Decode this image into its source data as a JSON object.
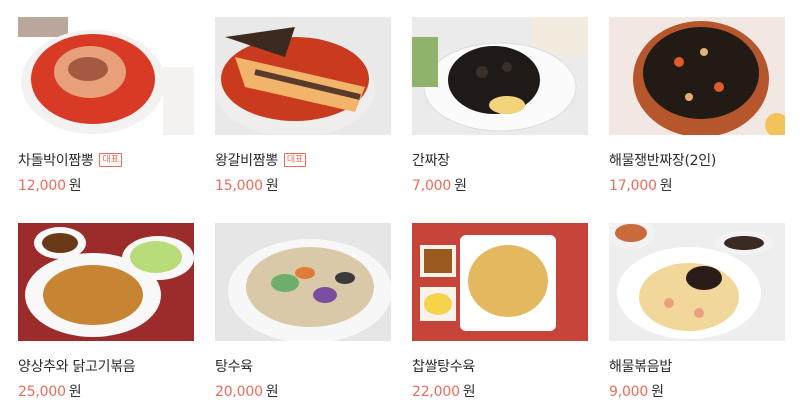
{
  "menu": {
    "items": [
      {
        "name": "차돌박이짬뽕",
        "badge": "대표",
        "price": "12,000",
        "unit": "원",
        "photo_icon": "spicy-noodle-soup-photo-icon",
        "palette": {
          "bg": "#ffffff",
          "plate": "#f4f2f0",
          "food": "#d83a26",
          "accent": "#e8a07a",
          "dark": "#7a2a1c"
        }
      },
      {
        "name": "왕갈비짬뽕",
        "badge": "대표",
        "price": "15,000",
        "unit": "원",
        "photo_icon": "rib-noodle-soup-photo-icon",
        "palette": {
          "bg": "#e9e9ea",
          "plate": "#f0eeec",
          "food": "#c93a1e",
          "accent": "#f2b46b",
          "dark": "#5a3a2a"
        }
      },
      {
        "name": "간짜장",
        "badge": "",
        "price": "7,000",
        "unit": "원",
        "photo_icon": "black-bean-noodle-photo-icon",
        "palette": {
          "bg": "#ecebeb",
          "plate": "#fbfbfb",
          "food": "#1f1a17",
          "accent": "#f0d37a",
          "dark": "#0e0b09"
        }
      },
      {
        "name": "해물쟁반짜장(2인)",
        "badge": "",
        "price": "17,000",
        "unit": "원",
        "photo_icon": "seafood-tray-jjajang-photo-icon",
        "palette": {
          "bg": "#f2e7e2",
          "plate": "#b6562c",
          "food": "#221a15",
          "accent": "#e15a2a",
          "dark": "#5c2a16"
        }
      },
      {
        "name": "양상추와 닭고기볶음",
        "badge": "",
        "price": "25,000",
        "unit": "원",
        "photo_icon": "lettuce-chicken-stirfry-photo-icon",
        "palette": {
          "bg": "#9c2b2b",
          "plate": "#f8f8f8",
          "food": "#c78432",
          "accent": "#b9dc7a",
          "dark": "#6a3a18"
        }
      },
      {
        "name": "탕수육",
        "badge": "",
        "price": "20,000",
        "unit": "원",
        "photo_icon": "sweet-sour-pork-photo-icon",
        "palette": {
          "bg": "#e6e6e6",
          "plate": "#f7f7f7",
          "food": "#d9c9a8",
          "accent": "#6fae6a",
          "dark": "#7a4da0"
        }
      },
      {
        "name": "찹쌀탕수육",
        "badge": "",
        "price": "22,000",
        "unit": "원",
        "photo_icon": "glutinous-rice-pork-photo-icon",
        "palette": {
          "bg": "#c7443a",
          "plate": "#ffffff",
          "food": "#e3b85e",
          "accent": "#f6d34a",
          "dark": "#9a5a20"
        }
      },
      {
        "name": "해물볶음밥",
        "badge": "",
        "price": "9,000",
        "unit": "원",
        "photo_icon": "seafood-fried-rice-photo-icon",
        "palette": {
          "bg": "#eeeeee",
          "plate": "#ffffff",
          "food": "#f1d79a",
          "accent": "#e9a17c",
          "dark": "#2a1c16"
        }
      }
    ]
  }
}
